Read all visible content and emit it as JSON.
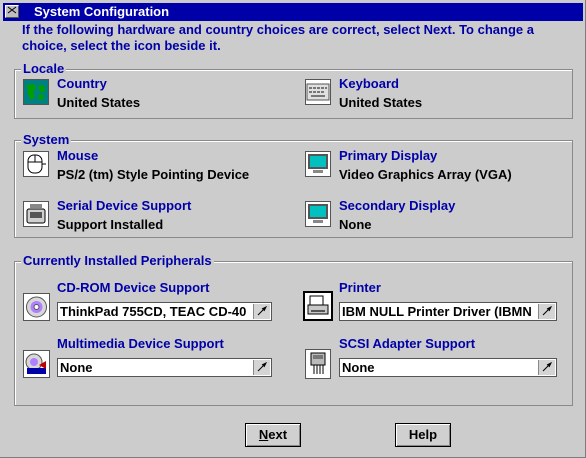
{
  "window": {
    "title": "System Configuration"
  },
  "intro": "If the following hardware and country choices are correct, select Next. To change a choice, select the icon beside it.",
  "locale": {
    "group_label": "Locale",
    "country": {
      "label": "Country",
      "value": "United States",
      "icon": "globe-icon"
    },
    "keyboard": {
      "label": "Keyboard",
      "value": "United States",
      "icon": "keyboard-icon"
    }
  },
  "system": {
    "group_label": "System",
    "mouse": {
      "label": "Mouse",
      "value": "PS/2 (tm) Style Pointing Device",
      "icon": "mouse-icon"
    },
    "primary_display": {
      "label": "Primary Display",
      "value": "Video Graphics Array (VGA)",
      "icon": "monitor-icon"
    },
    "serial": {
      "label": "Serial Device Support",
      "value": "Support Installed",
      "icon": "serial-device-icon"
    },
    "secondary_display": {
      "label": "Secondary Display",
      "value": "None",
      "icon": "monitor-icon"
    }
  },
  "peripherals": {
    "group_label": "Currently Installed Peripherals",
    "cdrom": {
      "label": "CD-ROM Device Support",
      "value": "ThinkPad 755CD, TEAC CD-40",
      "icon": "cdrom-icon"
    },
    "printer": {
      "label": "Printer",
      "value": "IBM NULL Printer Driver (IBMN",
      "icon": "printer-icon"
    },
    "multimedia": {
      "label": "Multimedia Device Support",
      "value": "None",
      "icon": "multimedia-icon"
    },
    "scsi": {
      "label": "SCSI Adapter Support",
      "value": "None",
      "icon": "scsi-icon"
    }
  },
  "buttons": {
    "next_mnemonic": "N",
    "next_rest": "ext",
    "help": "Help"
  },
  "colors": {
    "title_bar": "#0000a8",
    "label_text": "#0000a8",
    "window_bg": "#cccccc"
  }
}
